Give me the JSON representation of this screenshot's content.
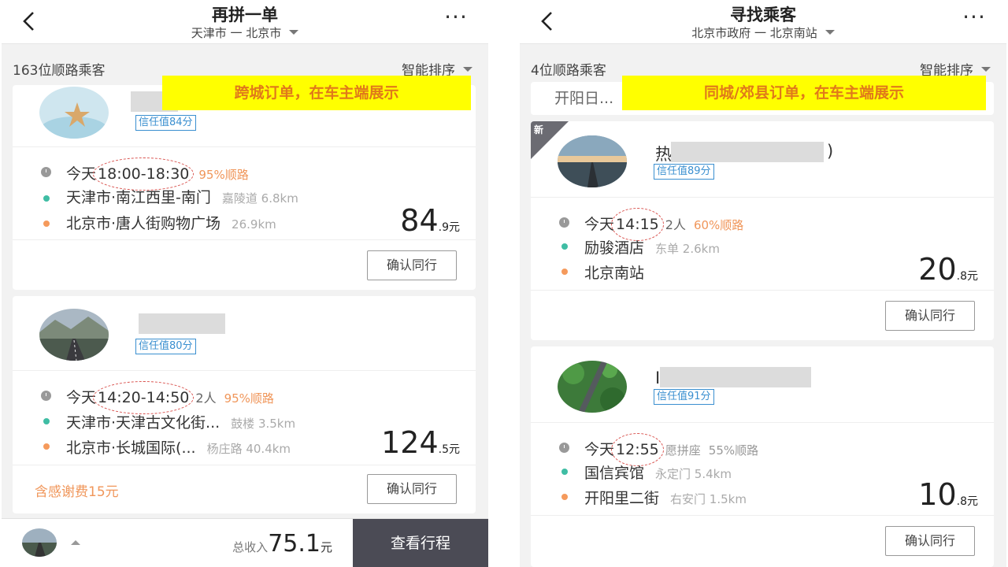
{
  "left": {
    "title": "再拼一单",
    "subtitle": "天津市 一 北京市",
    "count": "163位顺路乘客",
    "sort": "智能排序",
    "banner": "跨城订单，在车主端展示",
    "more": "···",
    "cards": [
      {
        "trust": "信任值84分",
        "day": "今天",
        "time": "18:00-18:30",
        "extra": "",
        "pct": "95%顺路",
        "from": "天津市·南江西里-南门",
        "from_detail": "嘉陵道 6.8km",
        "to": "北京市·唐人街购物广场",
        "to_detail": "26.9km",
        "price_int": "84",
        "price_dec": ".9元",
        "button": "确认同行"
      },
      {
        "trust": "信任值80分",
        "day": "今天",
        "time": "14:20-14:50",
        "extra": "2人",
        "pct": "95%顺路",
        "from": "天津市·天津古文化街...",
        "from_detail": "鼓楼 3.5km",
        "to": "北京市·长城国际(...",
        "to_detail": "杨庄路 40.4km",
        "price_int": "124",
        "price_dec": ".5元",
        "note": "含感谢费15元",
        "button": "确认同行"
      }
    ],
    "bottom": {
      "income_label": "总收入",
      "income_value": "75.1",
      "income_unit": "元",
      "view_trip": "查看行程"
    }
  },
  "right": {
    "title": "寻找乘客",
    "subtitle": "北京市政府 一 北京南站",
    "count": "4位顺路乘客",
    "sort": "智能排序",
    "banner": "同城/郊县订单，在车主端展示",
    "peek_text": "开阳日...",
    "more": "···",
    "new_tag": "新",
    "cards": [
      {
        "name_initial": "热",
        "name_tail": ")",
        "trust": "信任值89分",
        "day": "今天",
        "time": "14:15",
        "extra": "2人",
        "pct": "60%顺路",
        "from": "励骏酒店",
        "from_detail": "东单 2.6km",
        "to": "北京南站",
        "to_detail": "",
        "price_int": "20",
        "price_dec": ".8元",
        "button": "确认同行"
      },
      {
        "name_initial": "I",
        "trust": "信任值91分",
        "day": "今天",
        "time": "12:55",
        "extra": "愿拼座",
        "pct": "55%顺路",
        "from": "国信宾馆",
        "from_detail": "永定门 5.4km",
        "to": "开阳里二街",
        "to_detail": "右安门 1.5km",
        "price_int": "10",
        "price_dec": ".8元",
        "button": "确认同行"
      }
    ]
  }
}
